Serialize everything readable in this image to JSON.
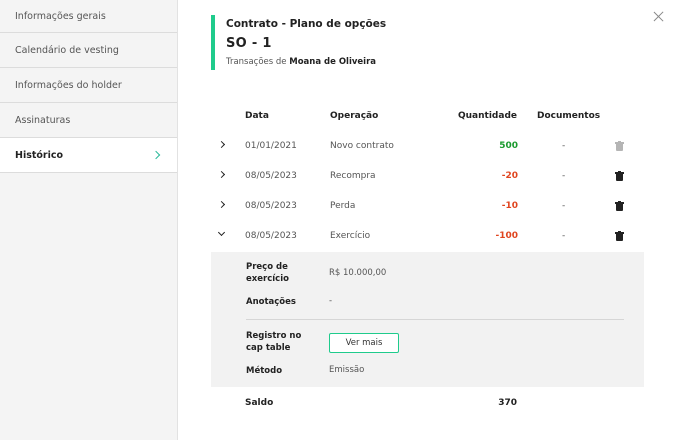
{
  "sidebar": {
    "items": [
      {
        "label": "Informações gerais"
      },
      {
        "label": "Calendário de vesting"
      },
      {
        "label": "Informações do holder"
      },
      {
        "label": "Assinaturas"
      },
      {
        "label": "Histórico",
        "active": true
      }
    ]
  },
  "header": {
    "title": "Contrato - Plano de opções",
    "code": "SO - 1",
    "subtitle_prefix": "Transações de ",
    "holder_name": "Moana de Oliveira",
    "accent_color": "#1fcb8c"
  },
  "table": {
    "headers": {
      "date": "Data",
      "operation": "Operação",
      "quantity": "Quantidade",
      "documents": "Documentos"
    },
    "rows": [
      {
        "date": "01/01/2021",
        "operation": "Novo contrato",
        "quantity": "500",
        "documents": "-",
        "expanded": false,
        "trash": "disabled"
      },
      {
        "date": "08/05/2023",
        "operation": "Recompra",
        "quantity": "-20",
        "documents": "-",
        "expanded": false,
        "trash": "enabled"
      },
      {
        "date": "08/05/2023",
        "operation": "Perda",
        "quantity": "-10",
        "documents": "-",
        "expanded": false,
        "trash": "enabled"
      },
      {
        "date": "08/05/2023",
        "operation": "Exercício",
        "quantity": "-100",
        "documents": "-",
        "expanded": true,
        "trash": "enabled"
      }
    ]
  },
  "details": {
    "exercise_price_label": "Preço de exercício",
    "exercise_price_value": "R$ 10.000,00",
    "notes_label": "Anotações",
    "notes_value": "-",
    "cap_table_label": "Registro no cap table",
    "cap_table_button": "Ver mais",
    "method_label": "Método",
    "method_value": "Emissão"
  },
  "footer": {
    "saldo_label": "Saldo",
    "saldo_value": "370"
  },
  "colors": {
    "positive": "#1a9a2e",
    "negative": "#e0451f"
  }
}
